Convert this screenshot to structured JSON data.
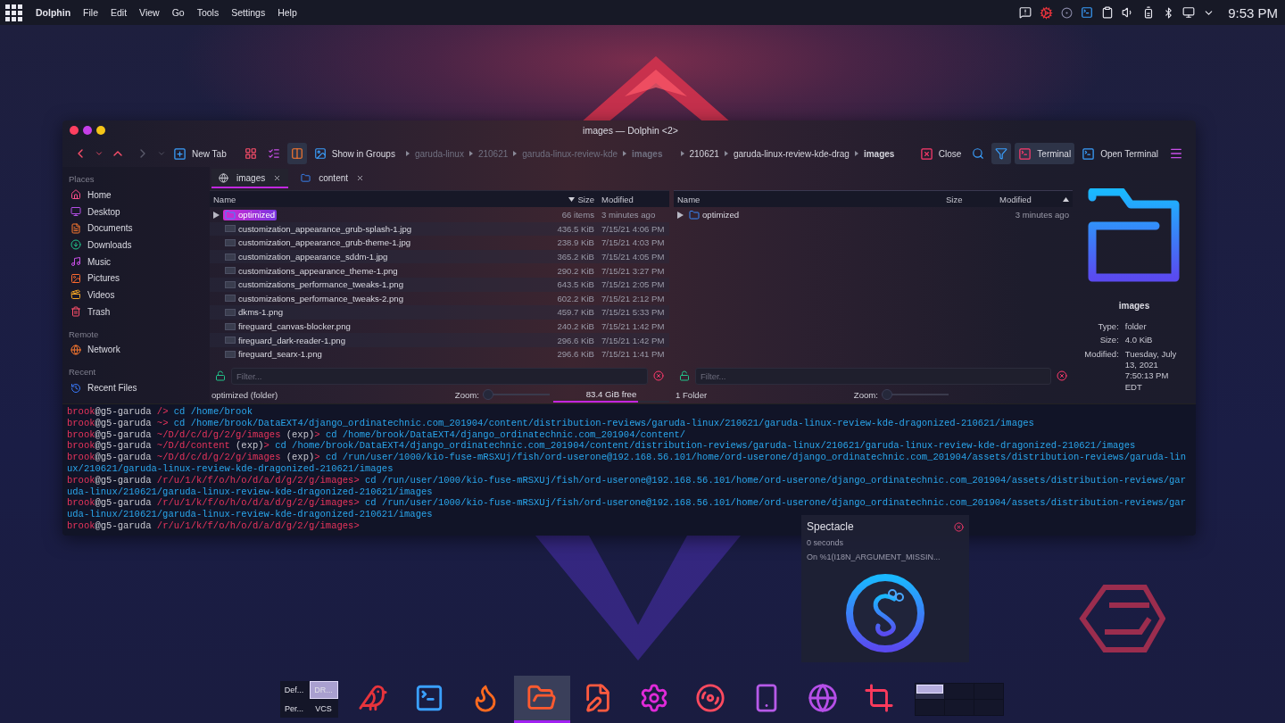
{
  "top_panel": {
    "app_name": "Dolphin",
    "menu": [
      "File",
      "Edit",
      "View",
      "Go",
      "Tools",
      "Settings",
      "Help"
    ],
    "clock": "9:53 PM"
  },
  "window": {
    "title": "images — Dolphin <2>"
  },
  "toolbar": {
    "new_tab": "New Tab",
    "show_in_groups": "Show in Groups",
    "close": "Close",
    "filter_on": true,
    "terminal": {
      "label": "Terminal",
      "on": true
    },
    "open_terminal": "Open Terminal",
    "split_on": true
  },
  "sidebar": {
    "groups": [
      {
        "title": "Places",
        "items": [
          {
            "label": "Home",
            "kind": "home"
          },
          {
            "label": "Desktop",
            "kind": "desktop"
          },
          {
            "label": "Documents",
            "kind": "documents"
          },
          {
            "label": "Downloads",
            "kind": "downloads"
          },
          {
            "label": "Music",
            "kind": "music"
          },
          {
            "label": "Pictures",
            "kind": "pictures"
          },
          {
            "label": "Videos",
            "kind": "videos"
          },
          {
            "label": "Trash",
            "kind": "trash"
          }
        ]
      },
      {
        "title": "Remote",
        "items": [
          {
            "label": "Network",
            "kind": "network"
          }
        ]
      },
      {
        "title": "Recent",
        "items": [
          {
            "label": "Recent Files",
            "kind": "recent"
          }
        ]
      }
    ]
  },
  "tabs": [
    {
      "label": "images",
      "kind": "network",
      "selected": true
    },
    {
      "label": "content",
      "kind": "folder",
      "selected": false
    }
  ],
  "panes": [
    {
      "active": false,
      "breadcrumbs": [
        {
          "label": "garuda-linux",
          "current": false
        },
        {
          "label": "210621",
          "current": false
        },
        {
          "label": "garuda-linux-review-kde",
          "current": false
        },
        {
          "label": "images",
          "current": true
        }
      ],
      "columns": [
        {
          "label": "Name",
          "sorted": false
        },
        {
          "label": "Size",
          "sorted": true,
          "ascending": false
        },
        {
          "label": "Modified",
          "sorted": false
        }
      ],
      "rows": [
        {
          "kind": "folder",
          "name": "optimized",
          "size": "66 items",
          "modified": "3 minutes ago",
          "selected": true,
          "expanded": false
        },
        {
          "kind": "image",
          "name": "customization_appearance_grub-splash-1.jpg",
          "size": "436.5 KiB",
          "modified": "7/15/21 4:06 PM",
          "selected": false
        },
        {
          "kind": "image",
          "name": "customization_appearance_grub-theme-1.jpg",
          "size": "238.9 KiB",
          "modified": "7/15/21 4:03 PM",
          "selected": false
        },
        {
          "kind": "image",
          "name": "customization_appearance_sddm-1.jpg",
          "size": "365.2 KiB",
          "modified": "7/15/21 4:05 PM",
          "selected": false
        },
        {
          "kind": "image",
          "name": "customizations_appearance_theme-1.png",
          "size": "290.2 KiB",
          "modified": "7/15/21 3:27 PM",
          "selected": false
        },
        {
          "kind": "image",
          "name": "customizations_performance_tweaks-1.png",
          "size": "643.5 KiB",
          "modified": "7/15/21 2:05 PM",
          "selected": false
        },
        {
          "kind": "image",
          "name": "customizations_performance_tweaks-2.png",
          "size": "602.2 KiB",
          "modified": "7/15/21 2:12 PM",
          "selected": false
        },
        {
          "kind": "image",
          "name": "dkms-1.png",
          "size": "459.7 KiB",
          "modified": "7/15/21 5:33 PM",
          "selected": false
        },
        {
          "kind": "image",
          "name": "fireguard_canvas-blocker.png",
          "size": "240.2 KiB",
          "modified": "7/15/21 1:42 PM",
          "selected": false
        },
        {
          "kind": "image",
          "name": "fireguard_dark-reader-1.png",
          "size": "296.6 KiB",
          "modified": "7/15/21 1:42 PM",
          "selected": false
        },
        {
          "kind": "image",
          "name": "fireguard_searx-1.png",
          "size": "296.6 KiB",
          "modified": "7/15/21 1:41 PM",
          "selected": false
        }
      ],
      "filter_placeholder": "Filter...",
      "status": "optimized (folder)",
      "zoom": {
        "label": "Zoom:",
        "level": 0
      },
      "free_space": {
        "text": "83.4 GiB free",
        "level": 0.73
      }
    },
    {
      "active": true,
      "breadcrumbs": [
        {
          "label": "210621",
          "current": false
        },
        {
          "label": "garuda-linux-review-kde-drag",
          "current": false
        },
        {
          "label": "images",
          "current": true
        }
      ],
      "columns": [
        {
          "label": "Name",
          "sorted": false
        },
        {
          "label": "Size",
          "sorted": false
        },
        {
          "label": "Modified",
          "sorted": true,
          "ascending": true
        }
      ],
      "rows": [
        {
          "kind": "folder",
          "name": "optimized",
          "modified": "3 minutes ago",
          "selected": false,
          "expanded": false
        }
      ],
      "filter_placeholder": "Filter...",
      "status": "1 Folder",
      "zoom": {
        "label": "Zoom:",
        "level": 0
      }
    }
  ],
  "info_panel": {
    "name": "images",
    "properties": [
      {
        "label": "Type:",
        "value": "folder"
      },
      {
        "label": "Size:",
        "value": "4.0 KiB"
      },
      {
        "label": "Modified:",
        "value": "Tuesday, July 13, 2021 7:50:13 PM EDT"
      }
    ]
  },
  "terminal": {
    "lines": [
      {
        "user": "brook",
        "host": "@g5-garuda",
        "path": "/",
        "symbol": ">",
        "command": "cd /home/brook"
      },
      {
        "user": "brook",
        "host": "@g5-garuda",
        "path": "~",
        "symbol": ">",
        "command": "cd /home/brook/DataEXT4/django_ordinatechnic.com_201904/content/distribution-reviews/garuda-linux/210621/garuda-linux-review-kde-dragonized-210621/images"
      },
      {
        "user": "brook",
        "host": "@g5-garuda",
        "path": "~/D/d/c/d/g/2/g/images",
        "tag": "(exp)",
        "symbol": ">",
        "command": "cd /home/brook/DataEXT4/django_ordinatechnic.com_201904/content/"
      },
      {
        "user": "brook",
        "host": "@g5-garuda",
        "path": "~/D/d/content",
        "tag": "(exp)",
        "symbol": ">",
        "command": "cd /home/brook/DataEXT4/django_ordinatechnic.com_201904/content/distribution-reviews/garuda-linux/210621/garuda-linux-review-kde-dragonized-210621/images"
      },
      {
        "user": "brook",
        "host": "@g5-garuda",
        "path": "~/D/d/c/d/g/2/g/images",
        "tag": "(exp)",
        "symbol": ">",
        "command": "cd /run/user/1000/kio-fuse-mRSXUj/fish/ord-userone@192.168.56.101/home/ord-userone/django_ordinatechnic.com_201904/assets/distribution-reviews/garuda-linux/210621/garuda-linux-review-kde-dragonized-210621/images"
      },
      {
        "user": "brook",
        "host": "@g5-garuda",
        "path": "/r/u/1/k/f/o/h/o/d/a/d/g/2/g/images",
        "symbol": ">",
        "command": "cd /run/user/1000/kio-fuse-mRSXUj/fish/ord-userone@192.168.56.101/home/ord-userone/django_ordinatechnic.com_201904/assets/distribution-reviews/garuda-linux/210621/garuda-linux-review-kde-dragonized-210621/images"
      },
      {
        "user": "brook",
        "host": "@g5-garuda",
        "path": "/r/u/1/k/f/o/h/o/d/a/d/g/2/g/images",
        "symbol": ">",
        "command": "cd /run/user/1000/kio-fuse-mRSXUj/fish/ord-userone@192.168.56.101/home/ord-userone/django_ordinatechnic.com_201904/assets/distribution-reviews/garuda-linux/210621/garuda-linux-review-kde-dragonized-210621/images"
      },
      {
        "user": "brook",
        "host": "@g5-garuda",
        "path": "/r/u/1/k/f/o/h/o/d/a/d/g/2/g/images",
        "symbol": ">"
      }
    ]
  },
  "notification": {
    "title": "Spectacle",
    "lines": [
      "0 seconds",
      "On %1(I18N_ARGUMENT_MISSIN..."
    ]
  },
  "dock": {
    "activities": [
      {
        "label": "Def...",
        "selected": false
      },
      {
        "label": "DR...",
        "selected": true
      },
      {
        "label": "Per...",
        "selected": false
      },
      {
        "label": "VCS",
        "selected": false
      }
    ],
    "tasks": [
      {
        "kind": "bird",
        "active": false
      },
      {
        "kind": "terminal",
        "active": false
      },
      {
        "kind": "flame",
        "active": false
      },
      {
        "kind": "folder",
        "active": true
      },
      {
        "kind": "editor",
        "active": false
      },
      {
        "kind": "gear",
        "active": false
      },
      {
        "kind": "disc",
        "active": false
      },
      {
        "kind": "phone",
        "active": false
      },
      {
        "kind": "globe",
        "active": false
      },
      {
        "kind": "crop",
        "active": false
      }
    ],
    "desktops": [
      {
        "selected": true
      },
      {
        "selected": false
      },
      {
        "selected": false
      },
      {
        "selected": false
      },
      {
        "selected": false
      },
      {
        "selected": false
      }
    ]
  }
}
